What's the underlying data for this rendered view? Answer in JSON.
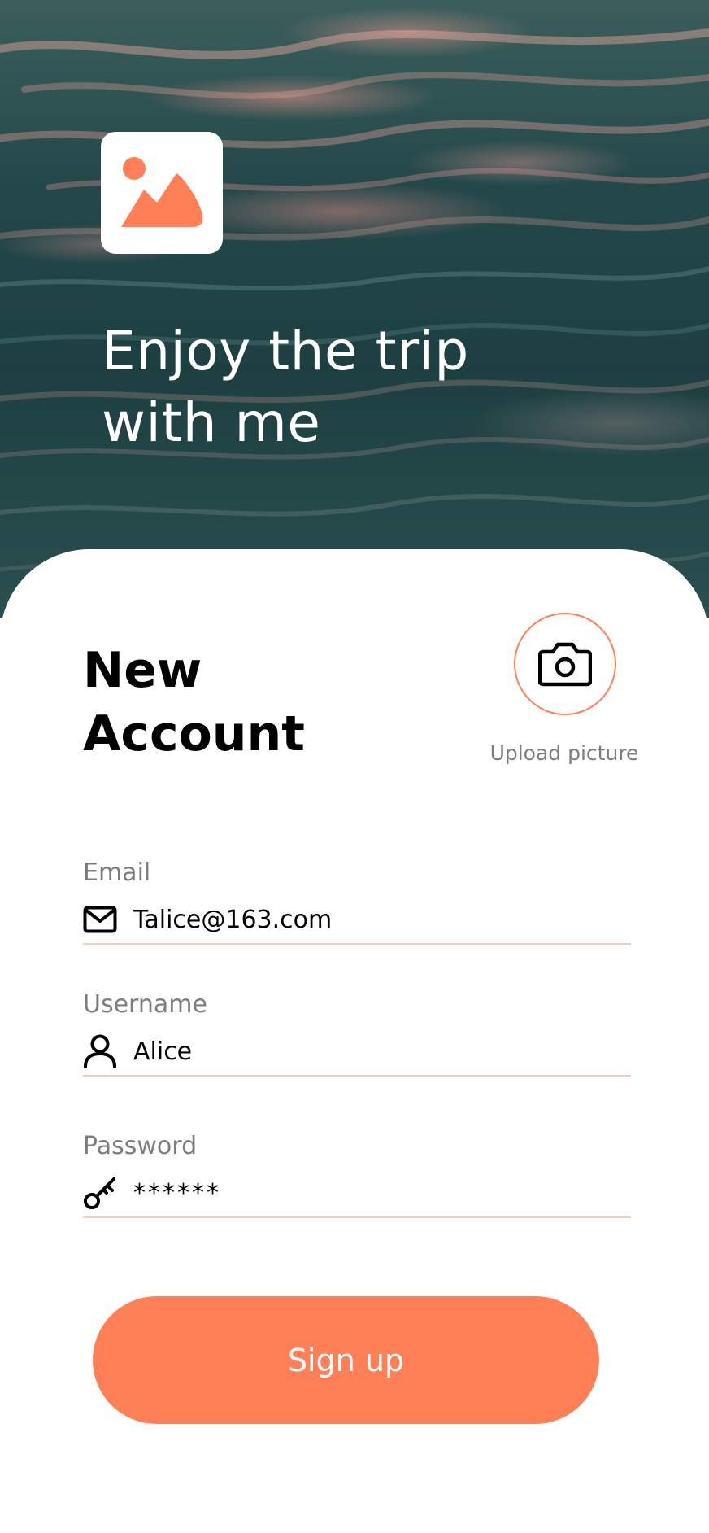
{
  "hero": {
    "title_line1": "Enjoy the trip",
    "title_line2": "with me",
    "logo_icon": "image-icon"
  },
  "card": {
    "title_line1": "New",
    "title_line2": "Account",
    "upload": {
      "icon": "camera-icon",
      "label": "Upload picture"
    }
  },
  "form": {
    "email": {
      "label": "Email",
      "icon": "mail-icon",
      "value": "Talice@163.com"
    },
    "username": {
      "label": "Username",
      "icon": "user-icon",
      "value": "Alice"
    },
    "password": {
      "label": "Password",
      "icon": "key-icon",
      "value": "******"
    }
  },
  "actions": {
    "signup_label": "Sign up"
  },
  "colors": {
    "accent": "#ff7f57",
    "underline": "#f6cbbd",
    "muted_text": "#7d7d7d"
  }
}
